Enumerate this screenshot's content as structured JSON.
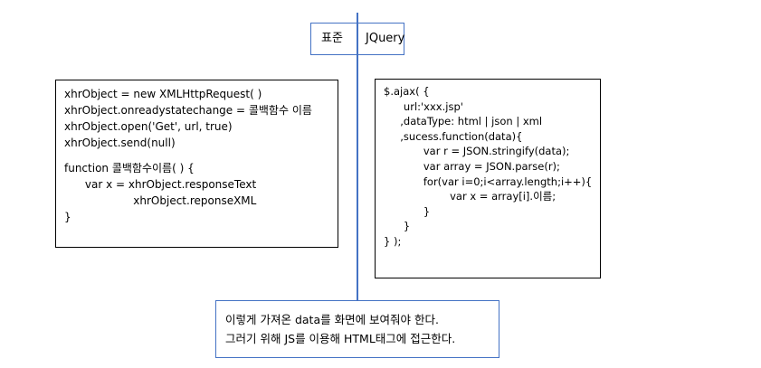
{
  "header": {
    "left_label": "표준",
    "right_label": "JQuery"
  },
  "left_code": {
    "lines": [
      "xhrObject = new XMLHttpRequest( )",
      "xhrObject.onreadystatechange = 콜백함수 이름",
      "xhrObject.open('Get', url, true)",
      "xhrObject.send(null)",
      "",
      "function 콜백함수이름( ) {",
      "      var x = xhrObject.responseText",
      "                    xhrObject.reponseXML",
      "}"
    ]
  },
  "right_code": {
    "lines": [
      "$.ajax( {",
      "      url:'xxx.jsp'",
      "     ,dataType: html | json | xml",
      "     ,sucess.function(data){",
      "            var r = JSON.stringify(data);",
      "            var array = JSON.parse(r);",
      "            for(var i=0;i<array.length;i++){",
      "                    var x = array[i].이름;",
      "            }",
      "      }",
      "} );"
    ]
  },
  "note": {
    "line1": "이렇게 가져온 data를 화면에 보여줘야 한다.",
    "line2": "그러기 위해 JS를 이용해 HTML태그에 접근한다."
  }
}
